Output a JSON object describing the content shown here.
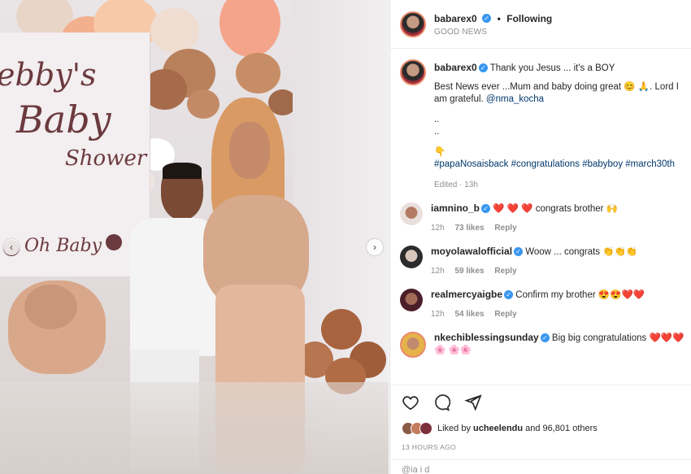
{
  "post": {
    "username": "babarex0",
    "separator": "•",
    "follow_label": "Following",
    "location": "GOOD NEWS"
  },
  "photo": {
    "banner_line1": "ebby's",
    "banner_line2": "Baby",
    "banner_line3": "Shower",
    "banner_line4": "Oh Baby"
  },
  "caption": {
    "username": "babarex0",
    "text1": "Thank you Jesus ... it's a BOY",
    "text2": "Best News ever ...Mum and baby doing great 😊 🙏. Lord I am grateful. ",
    "mention": "@nma_kocha",
    "dots1": "..",
    "dots2": "..",
    "emoji": "👇",
    "hashtags": "#papaNosaisback #congratulations #babyboy #march30th",
    "edited": "Edited",
    "time": "13h"
  },
  "comments": [
    {
      "username": "iamnino_b",
      "verified": true,
      "text": "❤️ ❤️ ❤️ congrats brother 🙌",
      "time": "12h",
      "likes": "73 likes",
      "reply": "Reply"
    },
    {
      "username": "moyolawalofficial",
      "verified": true,
      "text": "Woow ... congrats 👏👏👏",
      "time": "12h",
      "likes": "59 likes",
      "reply": "Reply"
    },
    {
      "username": "realmercyaigbe",
      "verified": true,
      "text": "Confirm my brother 😍😍❤️❤️",
      "time": "12h",
      "likes": "54 likes",
      "reply": "Reply"
    },
    {
      "username": "nkechiblessingsunday",
      "verified": true,
      "text": "Big big congratulations ❤️❤️❤️🌸 🌸🌸",
      "time": "",
      "likes": "",
      "reply": ""
    }
  ],
  "likes": {
    "prefix": "Liked by ",
    "user": "ucheelendu",
    "suffix": " and 96,801 others"
  },
  "timestamp": "13 HOURS AGO",
  "add_comment_placeholder": "@ia   i   d",
  "icons": [
    "heart-icon",
    "comment-icon",
    "share-icon",
    "chevron-left-icon",
    "chevron-right-icon"
  ],
  "colors": {
    "link": "#00376b",
    "verified": "#3897f0",
    "muted": "#8e8e8e"
  }
}
